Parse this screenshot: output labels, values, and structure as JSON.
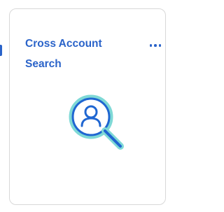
{
  "card": {
    "title": "Cross Account\nSearch",
    "menu_icon": "more-horizontal-icon",
    "illustration_icon": "user-search-icon"
  },
  "colors": {
    "accent": "#2a63c9",
    "icon_stroke": "#1f66d1",
    "icon_glow": "#7fd9d6",
    "card_border": "#d8d8d8"
  }
}
